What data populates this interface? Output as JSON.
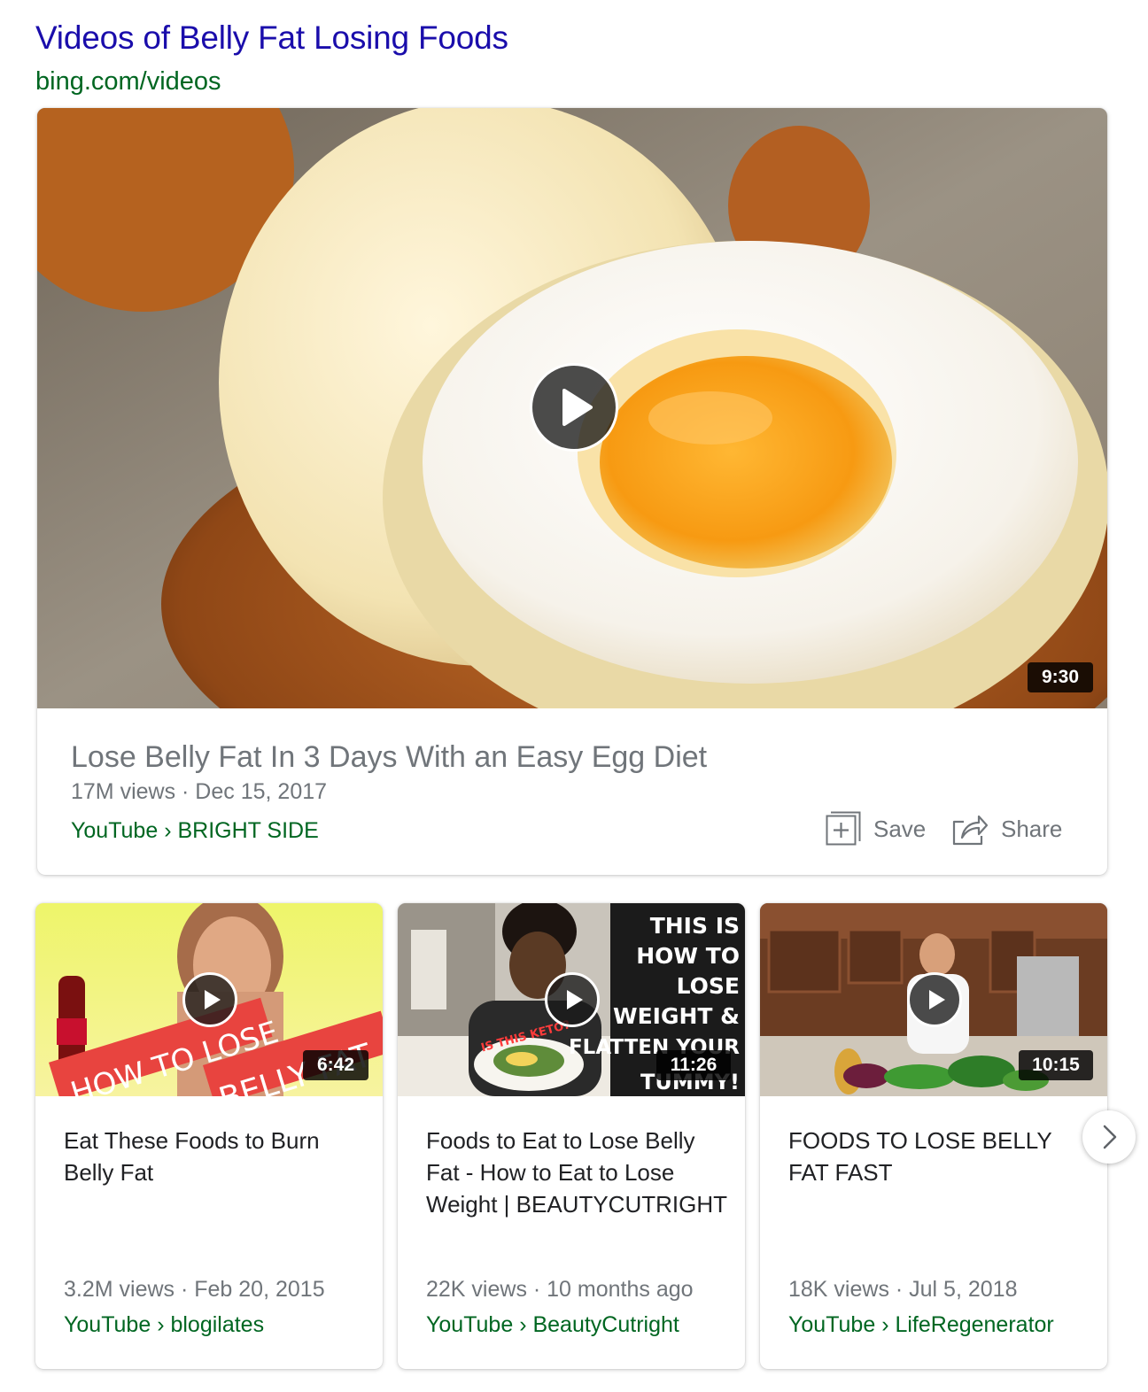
{
  "header": {
    "title": "Videos of Belly Fat Losing Foods",
    "url": "bing.com/videos"
  },
  "featured": {
    "duration": "9:30",
    "title": "Lose Belly Fat In 3 Days With an Easy Egg Diet",
    "meta": "17M views · Dec 15, 2017",
    "source": "YouTube › BRIGHT SIDE",
    "save_label": "Save",
    "share_label": "Share"
  },
  "videos": [
    {
      "duration": "6:42",
      "thumb_text": [
        "HOW TO LOSE",
        "BELLY FAT"
      ],
      "title": "Eat These Foods to Burn Belly Fat",
      "meta": "3.2M views · Feb 20, 2015",
      "source": "YouTube › blogilates"
    },
    {
      "duration": "11:26",
      "thumb_text": [
        "THIS IS",
        "HOW TO",
        "LOSE",
        "WEIGHT &",
        "FLATTEN YOUR",
        "TUMMY!",
        "IS THIS KETO?"
      ],
      "title": "Foods to Eat to Lose Belly Fat - How to Eat to Lose Weight | BEAUTYCUTRIGHT",
      "meta": "22K views · 10 months ago",
      "source": "YouTube › BeautyCutright"
    },
    {
      "duration": "10:15",
      "title": "FOODS TO LOSE BELLY FAT FAST",
      "meta": "18K views · Jul 5, 2018",
      "source": "YouTube › LifeRegenerator"
    }
  ],
  "colors": {
    "link": "#1a0dab",
    "url_green": "#006621",
    "meta_gray": "#70757a"
  },
  "icons": {
    "play": "play-icon",
    "save": "save-icon",
    "share": "share-icon",
    "next": "chevron-right-icon"
  }
}
